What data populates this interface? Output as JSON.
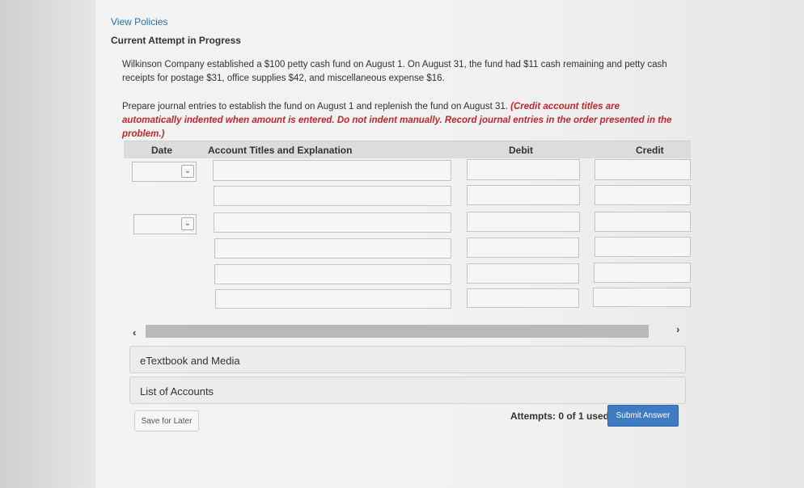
{
  "header": {
    "view_policies": "View Policies",
    "attempt_status": "Current Attempt in Progress"
  },
  "question": {
    "line1": "Wilkinson Company established a $100 petty cash fund on August 1. On August 31, the fund had $11 cash remaining and petty cash",
    "line2": "receipts for postage $31, office supplies $42, and miscellaneous expense $16."
  },
  "instructions": {
    "line1_plain": "Prepare journal entries to establish the fund on August 1 and replenish the fund on August 31. ",
    "line1_red": "(Credit account titles are",
    "line2_red": "automatically indented when amount is entered. Do not indent manually. Record journal entries in the order presented in the problem.)"
  },
  "table": {
    "col_date": "Date",
    "col_account": "Account Titles and Explanation",
    "col_debit": "Debit",
    "col_credit": "Credit"
  },
  "panels": {
    "etextbook": "eTextbook and Media",
    "accounts": "List of Accounts"
  },
  "footer": {
    "save_label": "Save for Later",
    "attempts_label": "Attempts: 0 of 1 used",
    "submit_label": "Submit Answer"
  },
  "icons": {
    "dropdown": "chevron-down-icon",
    "scroll_left": "chevron-left-icon",
    "scroll_right": "chevron-right-icon"
  },
  "colors": {
    "link": "#2a6fb3",
    "instruction_red": "#c0272d",
    "submit_bg": "#3f7bc3"
  }
}
